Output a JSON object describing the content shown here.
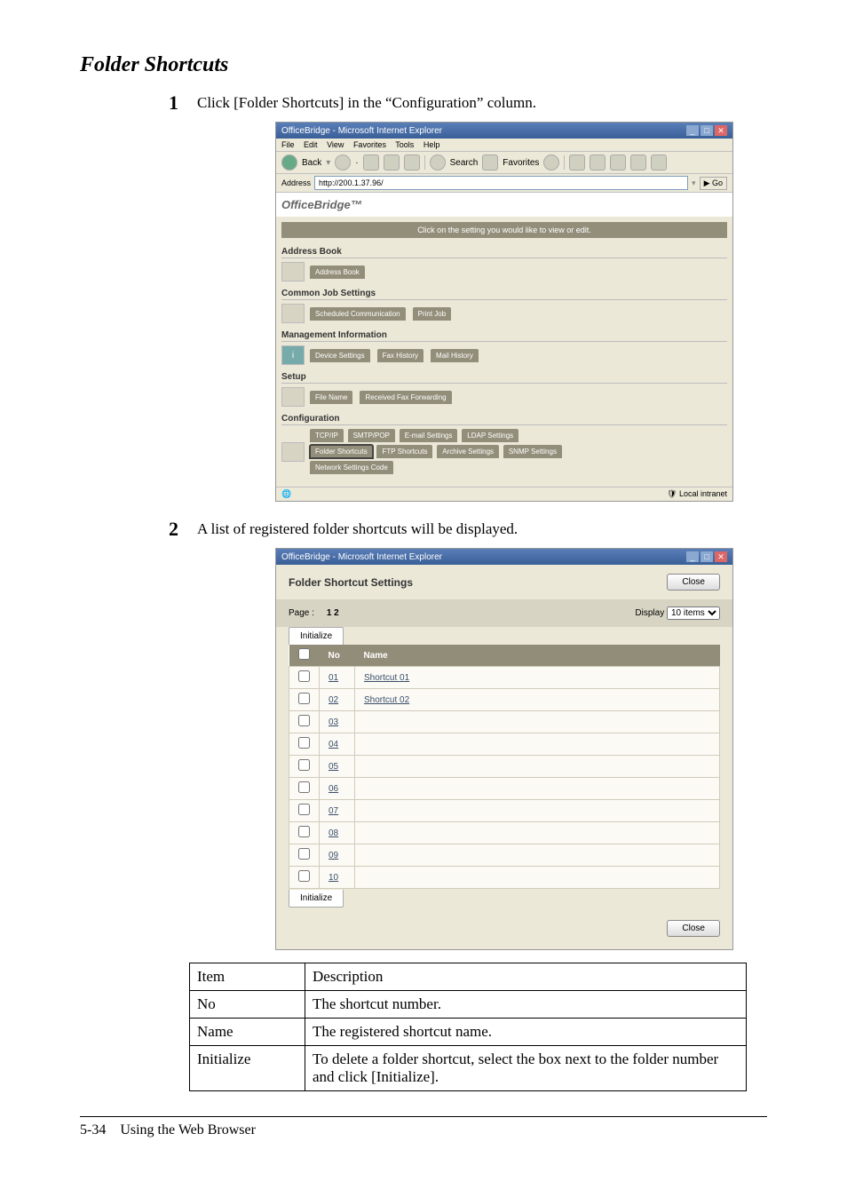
{
  "section_title": "Folder Shortcuts",
  "steps": [
    {
      "num": "1",
      "text": "Click [Folder Shortcuts] in the “Configuration” column."
    },
    {
      "num": "2",
      "text": "A list of registered folder shortcuts will be displayed."
    }
  ],
  "browser1": {
    "title": "OfficeBridge - Microsoft Internet Explorer",
    "menu": {
      "file": "File",
      "edit": "Edit",
      "view": "View",
      "fav": "Favorites",
      "tools": "Tools",
      "help": "Help"
    },
    "toolbar": {
      "back": "Back",
      "search": "Search",
      "favorites": "Favorites"
    },
    "address_label": "Address",
    "address_value": "http://200.1.37.96/",
    "go": "Go",
    "logo": "OfficeBridge™",
    "infobar": "Click on the setting you would like to view or edit.",
    "sections": {
      "address": {
        "head": "Address Book",
        "tabs": [
          "Address Book"
        ]
      },
      "common": {
        "head": "Common Job Settings",
        "tabs": [
          "Scheduled Communication",
          "Print Job"
        ]
      },
      "mgmt": {
        "head": "Management Information",
        "tabs": [
          "Device Settings",
          "Fax History",
          "Mail History"
        ]
      },
      "setup": {
        "head": "Setup",
        "tabs": [
          "File Name",
          "Received Fax Forwarding"
        ]
      },
      "config": {
        "head": "Configuration",
        "row1": [
          "TCP/IP",
          "SMTP/POP",
          "E-mail Settings",
          "LDAP Settings"
        ],
        "row2": [
          "Folder Shortcuts",
          "FTP Shortcuts",
          "Archive Settings",
          "SNMP Settings"
        ],
        "row3": [
          "Network Settings Code"
        ]
      }
    },
    "status_right": "Local intranet"
  },
  "browser2": {
    "title": "OfficeBridge - Microsoft Internet Explorer",
    "heading": "Folder Shortcut Settings",
    "close": "Close",
    "page_label": "Page :",
    "page_values": "1 2",
    "display_label": "Display",
    "display_value": "10 items",
    "initialize": "Initialize",
    "col_no": "No",
    "col_name": "Name",
    "rows": [
      {
        "no": "01",
        "name": "Shortcut 01"
      },
      {
        "no": "02",
        "name": "Shortcut 02"
      },
      {
        "no": "03",
        "name": ""
      },
      {
        "no": "04",
        "name": ""
      },
      {
        "no": "05",
        "name": ""
      },
      {
        "no": "06",
        "name": ""
      },
      {
        "no": "07",
        "name": ""
      },
      {
        "no": "08",
        "name": ""
      },
      {
        "no": "09",
        "name": ""
      },
      {
        "no": "10",
        "name": ""
      }
    ]
  },
  "desc_table": {
    "header": {
      "item": "Item",
      "desc": "Description"
    },
    "rows": [
      {
        "item": "No",
        "desc": "The shortcut number."
      },
      {
        "item": "Name",
        "desc": "The registered shortcut name."
      },
      {
        "item": "Initialize",
        "desc": "To delete a folder shortcut, select the box next to the folder number and click [Initialize]."
      }
    ]
  },
  "footer": {
    "page": "5-34",
    "label": "Using the Web Browser"
  }
}
